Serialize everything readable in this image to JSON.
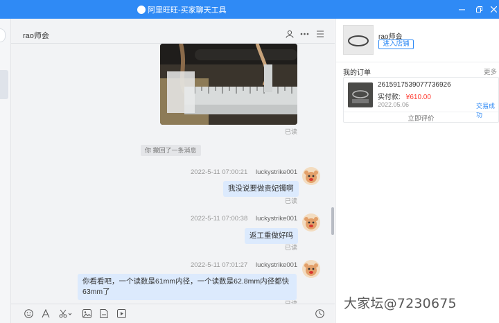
{
  "window": {
    "title": "阿里旺旺-买家聊天工具",
    "controls": [
      "minimize",
      "restore",
      "close"
    ]
  },
  "chat": {
    "contact_name": "rao师会",
    "header_icons": [
      "user-icon",
      "more-icon",
      "menu-icon"
    ],
    "messages": [
      {
        "type": "image",
        "status": "已读"
      },
      {
        "type": "notice",
        "text": "你 撤回了一条消息"
      },
      {
        "type": "text",
        "time": "2022-5-11 07:00:21",
        "sender": "luckystrike001",
        "text": "我没说要做贵妃镯啊",
        "status": "已读"
      },
      {
        "type": "text",
        "time": "2022-5-11 07:00:38",
        "sender": "luckystrike001",
        "text": "返工重做好吗",
        "status": "已读"
      },
      {
        "type": "text",
        "time": "2022-5-11 07:01:27",
        "sender": "luckystrike001",
        "text_line1": "你看看吧，一个读数是61mm内径，一个读数是62.8mm内径都快",
        "text_line2": "63mm了",
        "status": "已读"
      }
    ],
    "toolbar_icons": [
      "emoji-icon",
      "font-icon",
      "scissors-icon",
      "image-icon",
      "file-icon",
      "video-icon",
      "history-icon"
    ]
  },
  "shop": {
    "name": "rao师会",
    "enter_button": "进入店铺"
  },
  "orders": {
    "title": "我的订单",
    "more": "更多",
    "items": [
      {
        "id": "2615917539077736926",
        "paid_label": "实付款:",
        "price": "¥610.00",
        "date": "2022.05.06",
        "status": "交易成功",
        "review": "立即评价"
      }
    ]
  },
  "watermark": "大家坛@7230675",
  "colors": {
    "titlebar": "#2f8af5",
    "bubble": "#dceafd",
    "price": "#ff3a2f"
  }
}
